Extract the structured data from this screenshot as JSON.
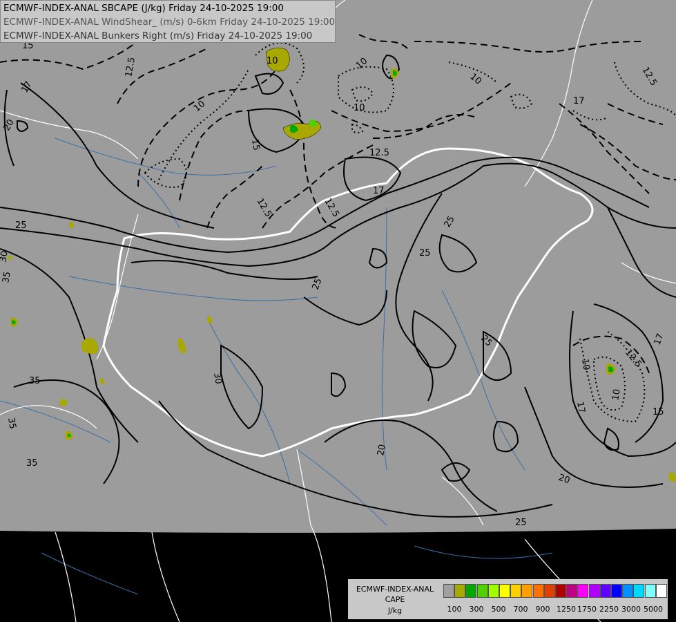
{
  "header": {
    "line1": "ECMWF-INDEX-ANAL SBCAPE (J/kg) Friday 24-10-2025 19:00",
    "line2": "ECMWF-INDEX-ANAL WindShear_ (m/s) 0-6km Friday 24-10-2025 19:00",
    "line3": "ECMWF-INDEX-ANAL Bunkers Right (m/s) Friday 24-10-2025 19:00"
  },
  "legend": {
    "title1": "ECMWF-INDEX-ANAL",
    "title2": "CAPE",
    "unit": "J/kg",
    "colors": [
      "#a0a0a0",
      "#a8a800",
      "#00a800",
      "#50d000",
      "#a0ff00",
      "#ffff00",
      "#ffd000",
      "#ffa000",
      "#ff7000",
      "#e04000",
      "#b00000",
      "#c00080",
      "#ff00ff",
      "#b000ff",
      "#6000ff",
      "#0000ff",
      "#0090ff",
      "#00d8ff",
      "#80ffff",
      "#ffffff"
    ],
    "ticks": [
      "100",
      "300",
      "500",
      "700",
      "900",
      "1250",
      "1750",
      "2250",
      "3000",
      "5000"
    ]
  },
  "contour_labels": [
    "15",
    "17",
    "20",
    "25",
    "25",
    "30",
    "35",
    "35",
    "35",
    "12.5",
    "12.5",
    "12.5",
    "12.5",
    "12.5",
    "10",
    "10",
    "10",
    "10",
    "10",
    "10",
    "15",
    "15",
    "15",
    "17",
    "17",
    "17",
    "20",
    "20",
    "25",
    "25",
    "25",
    "25",
    "30",
    "35",
    "12.5",
    "17",
    "10"
  ],
  "colors": {
    "ocean": "#000000",
    "land_outside": "#000000",
    "domain": "#9c9c9c",
    "contour": "#000000",
    "border": "#ffffff",
    "river": "#3a6fa8",
    "cape_100": "#a8a800",
    "cape_300": "#00a800",
    "cape_500": "#50d000"
  }
}
